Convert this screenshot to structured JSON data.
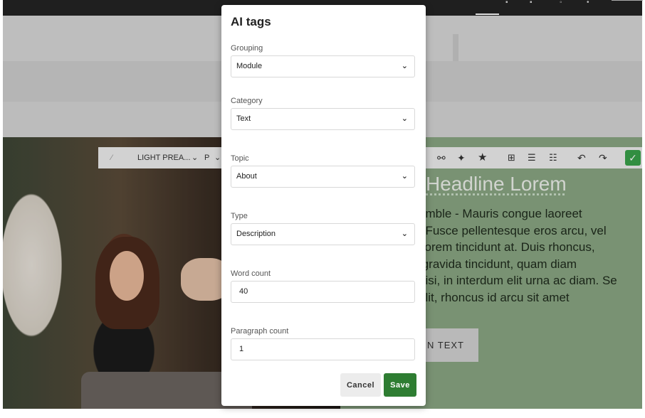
{
  "modal": {
    "title": "AI tags",
    "fields": {
      "grouping": {
        "label": "Grouping",
        "value": "Module"
      },
      "category": {
        "label": "Category",
        "value": "Text"
      },
      "topic": {
        "label": "Topic",
        "value": "About"
      },
      "type": {
        "label": "Type",
        "value": "Description"
      },
      "word_count": {
        "label": "Word count",
        "value": "40"
      },
      "paragraph_count": {
        "label": "Paragraph count",
        "value": "1"
      }
    },
    "cancel_label": "Cancel",
    "save_label": "Save"
  },
  "editor_toolbar": {
    "style_select": "LIGHT PREA...",
    "block_select": "P",
    "tools": [
      "magic-wand-icon",
      "link-icon",
      "ai-sparkle-icon",
      "star-icon",
      "table-icon",
      "bullet-list-icon",
      "numbered-list-icon",
      "undo-icon",
      "redo-icon",
      "confirm-check-icon"
    ]
  },
  "background": {
    "headline": "Headline Lorem",
    "paragraph_lines": [
      "amble - Mauris congue laoreet",
      ". Fusce pellentesque eros arcu, vel",
      " lorem tincidunt at. Duis rhoncus,",
      " gravida tincidunt, quam diam",
      "nisi, in interdum elit urna ac diam. Se",
      "elit, rhoncus id arcu sit amet"
    ],
    "button_text": "N TEXT"
  },
  "colors": {
    "save": "#2e7d32",
    "green_panel": "#8aa783",
    "topbar": "#1f1f1f"
  }
}
